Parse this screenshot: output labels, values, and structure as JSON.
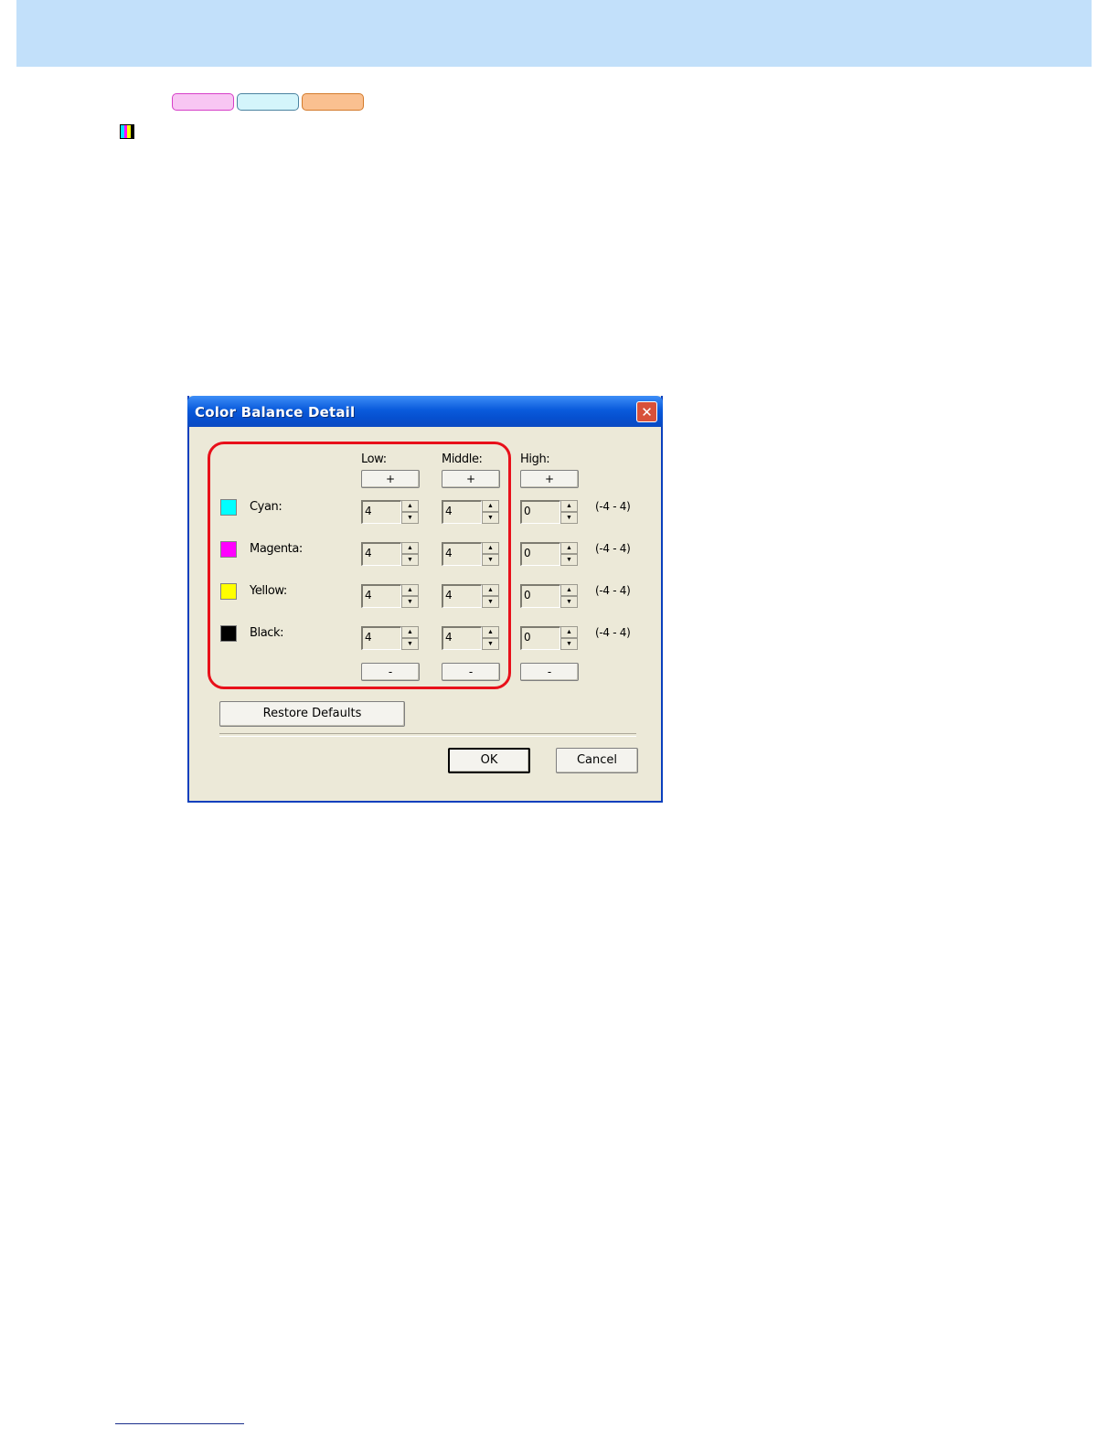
{
  "dialog": {
    "title": "Color Balance Detail",
    "close_glyph": "✕",
    "columns": {
      "low": "Low:",
      "middle": "Middle:",
      "high": "High:"
    },
    "plus_label": "+",
    "minus_label": "-",
    "rows": [
      {
        "label": "Cyan:",
        "color": "#00ffff",
        "low": "4",
        "middle": "4",
        "high": "0",
        "range": "(-4 - 4)"
      },
      {
        "label": "Magenta:",
        "color": "#ff00ff",
        "low": "4",
        "middle": "4",
        "high": "0",
        "range": "(-4 - 4)"
      },
      {
        "label": "Yellow:",
        "color": "#ffff00",
        "low": "4",
        "middle": "4",
        "high": "0",
        "range": "(-4 - 4)"
      },
      {
        "label": "Black:",
        "color": "#000000",
        "low": "4",
        "middle": "4",
        "high": "0",
        "range": "(-4 - 4)"
      }
    ],
    "restore_defaults": "Restore Defaults",
    "ok": "OK",
    "cancel": "Cancel"
  },
  "page": {
    "header_color": "#c2e0fa",
    "tab_colors": [
      "#f8c6f3",
      "#d4f5fb",
      "#fac090"
    ],
    "icon": "cmyk-bars-icon",
    "highlight_color": "#e8101a"
  }
}
